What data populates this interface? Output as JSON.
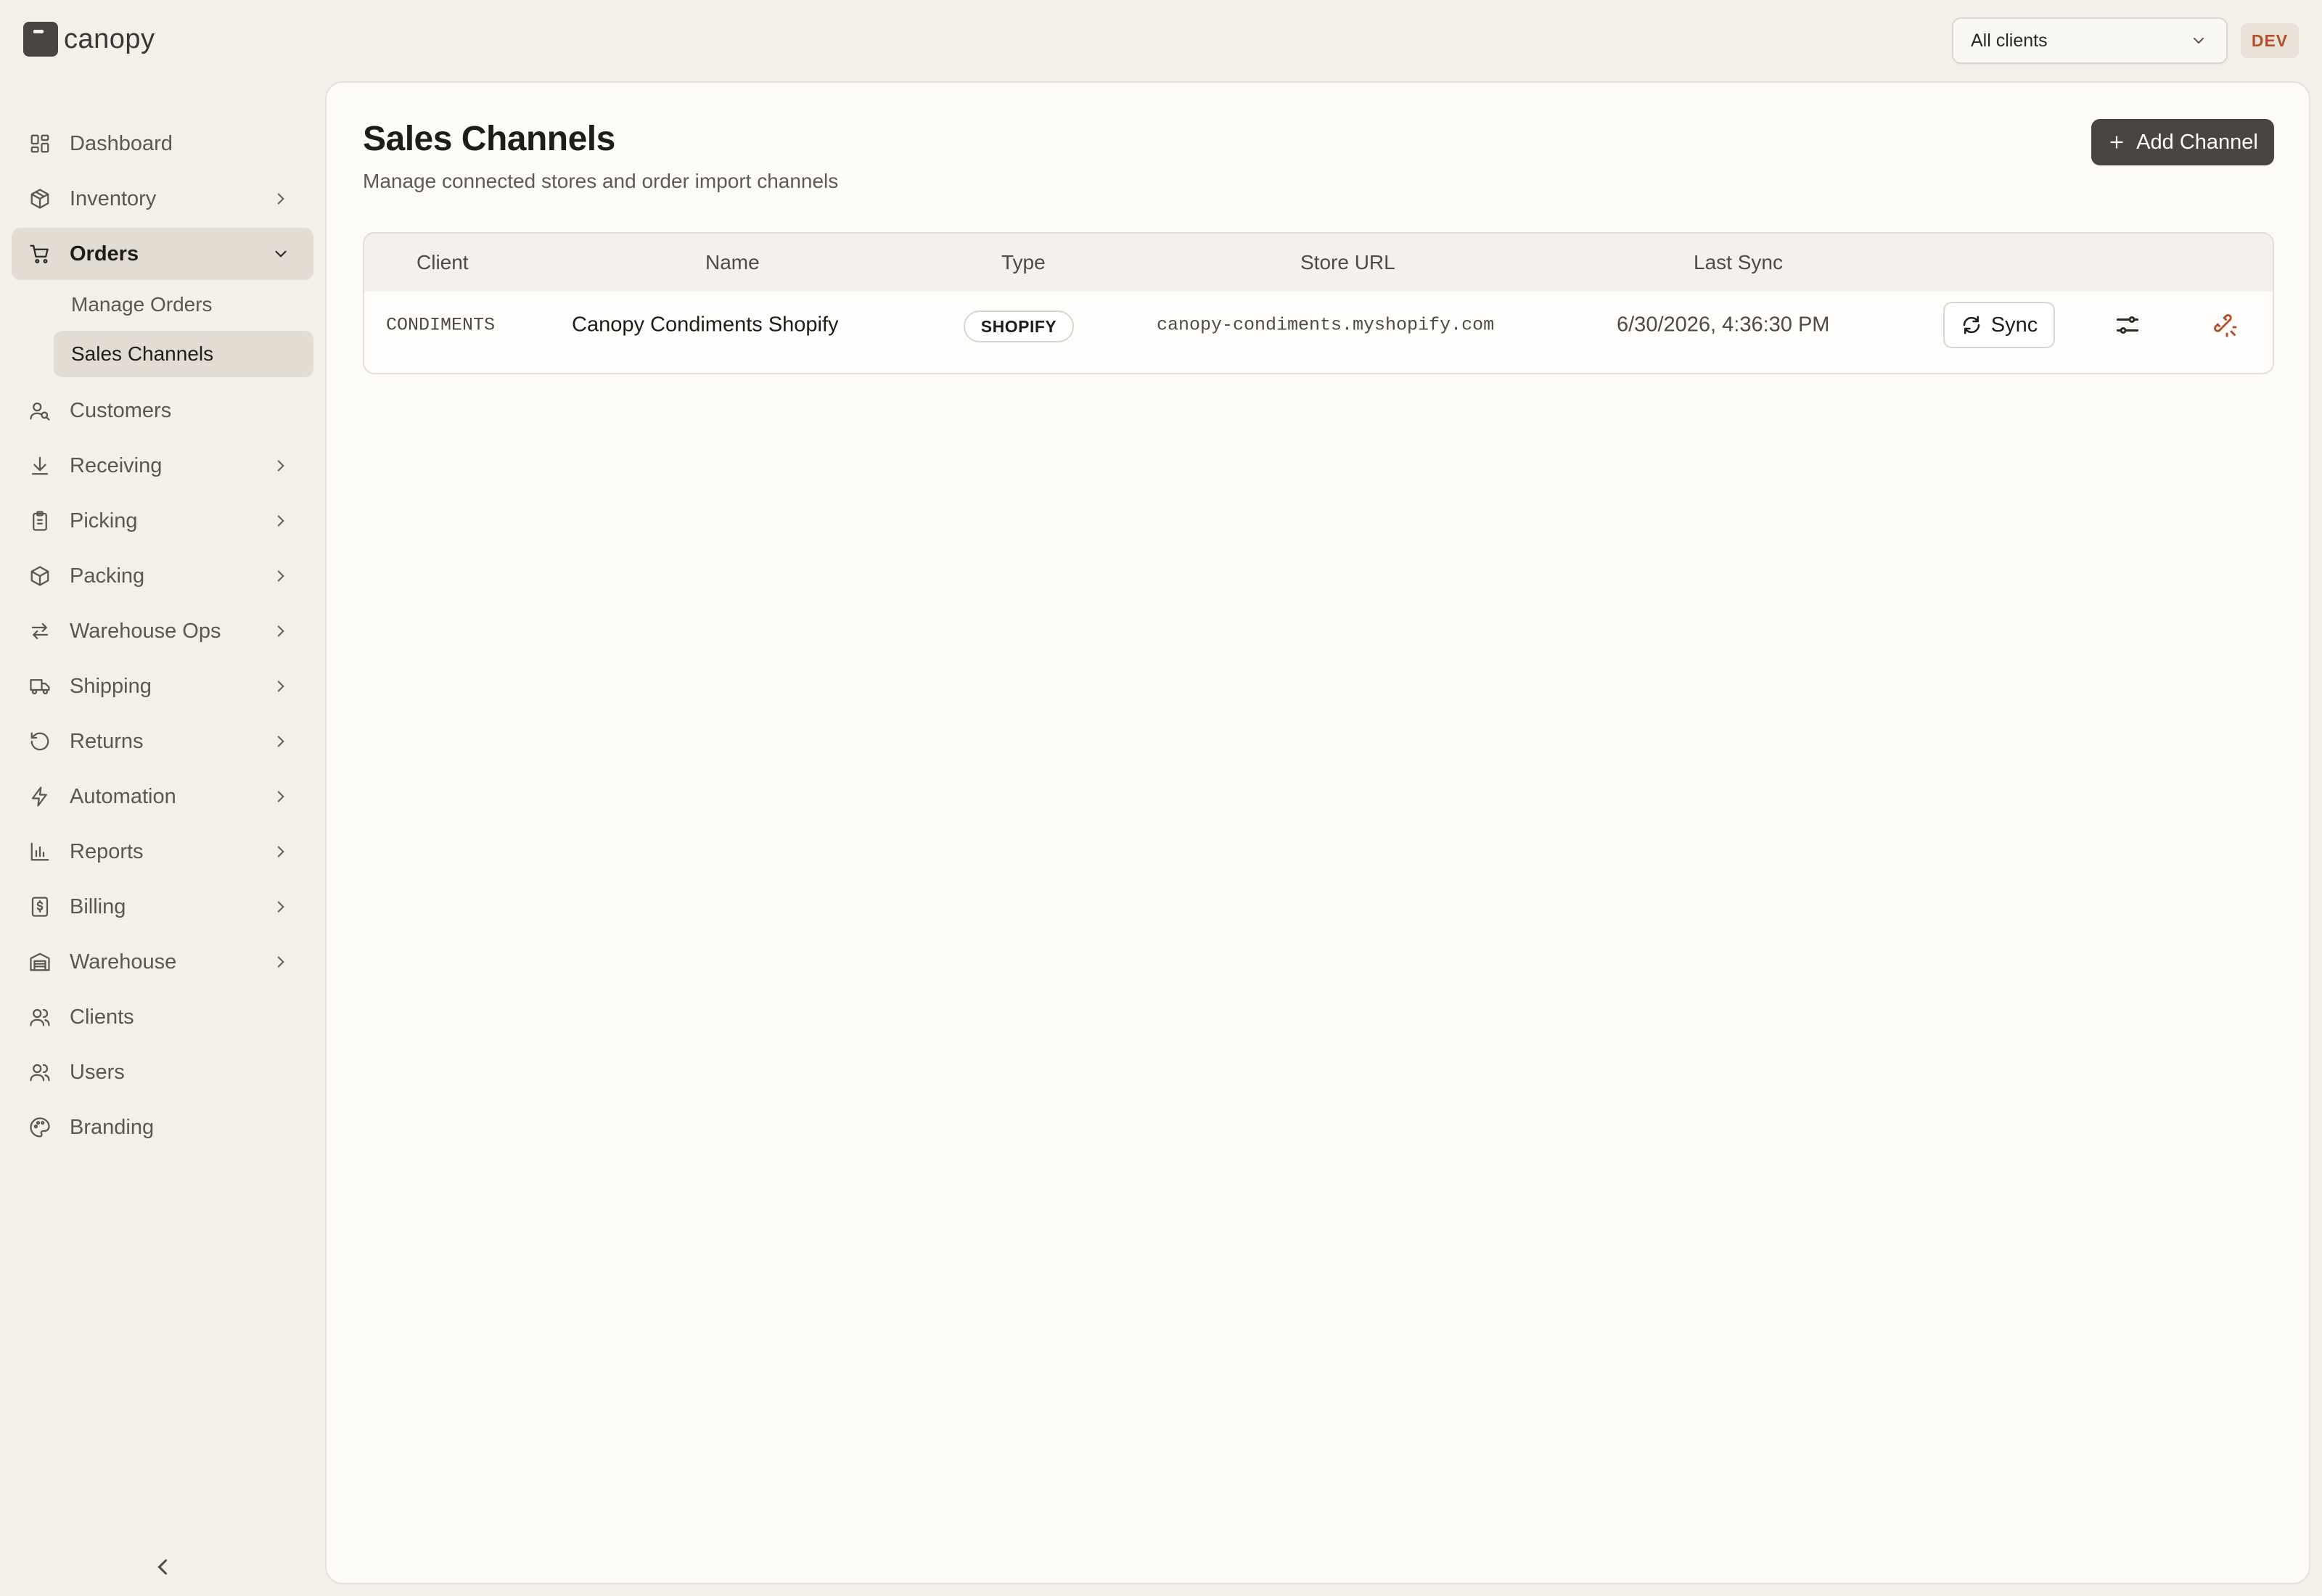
{
  "app": {
    "logo_text": "canopy",
    "env_badge": "DEV"
  },
  "client_filter": {
    "value": "All clients"
  },
  "sidebar": {
    "items": [
      {
        "label": "Dashboard",
        "icon": "dashboard-icon"
      },
      {
        "label": "Inventory",
        "icon": "box-icon"
      },
      {
        "label": "Orders",
        "icon": "cart-icon",
        "expanded": true,
        "children": [
          {
            "label": "Manage Orders"
          },
          {
            "label": "Sales Channels",
            "active": true
          }
        ]
      },
      {
        "label": "Customers",
        "icon": "customers-icon"
      },
      {
        "label": "Receiving",
        "icon": "download-icon"
      },
      {
        "label": "Picking",
        "icon": "clipboard-icon"
      },
      {
        "label": "Packing",
        "icon": "package-icon"
      },
      {
        "label": "Warehouse Ops",
        "icon": "arrows-icon"
      },
      {
        "label": "Shipping",
        "icon": "truck-icon"
      },
      {
        "label": "Returns",
        "icon": "return-icon"
      },
      {
        "label": "Automation",
        "icon": "bolt-icon"
      },
      {
        "label": "Reports",
        "icon": "bar-chart-icon"
      },
      {
        "label": "Billing",
        "icon": "billing-icon"
      },
      {
        "label": "Warehouse",
        "icon": "warehouse-icon"
      },
      {
        "label": "Clients",
        "icon": "clients-icon"
      },
      {
        "label": "Users",
        "icon": "users-icon"
      },
      {
        "label": "Branding",
        "icon": "palette-icon"
      }
    ]
  },
  "page": {
    "title": "Sales Channels",
    "subtitle": "Manage connected stores and order import channels",
    "add_button_label": "Add Channel"
  },
  "table": {
    "columns": [
      "Client",
      "Name",
      "Type",
      "Store URL",
      "Last Sync"
    ],
    "rows": [
      {
        "client": "CONDIMENTS",
        "name": "Canopy Condiments Shopify",
        "type": "SHOPIFY",
        "store_url": "canopy-condiments.myshopify.com",
        "last_sync": "6/30/2026, 4:36:30 PM",
        "sync_label": "Sync"
      }
    ]
  },
  "colors": {
    "accent_dark": "#4a4540",
    "active_bg": "#e2dcd3",
    "danger": "#b5502e",
    "page_bg": "#f3f0ea"
  }
}
